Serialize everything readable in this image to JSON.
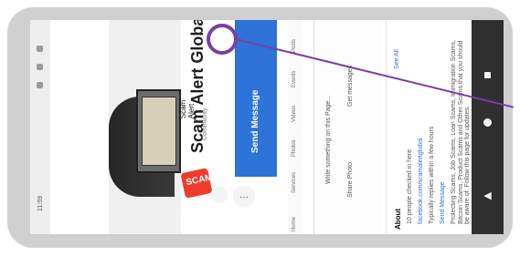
{
  "status_bar": {
    "time": "11:59"
  },
  "hero": {
    "sign_text": "Scam Alert"
  },
  "profile": {
    "name": "Scam Alert Global",
    "meta": "Community",
    "logo_text": "SCAM"
  },
  "buttons": {
    "send_message": "Send Message"
  },
  "tabs": [
    "Home",
    "Services",
    "Photos",
    "Videos",
    "Events",
    "Posts"
  ],
  "composer": {
    "placeholder": "Write something on this Page...",
    "actions": [
      "Share Photo",
      "Get messages"
    ]
  },
  "about": {
    "title": "About",
    "link_text": "See All",
    "items": [
      "10 people checked in here",
      "facebook.com/scamalertglobal",
      "Typically replies within a few hours",
      "Send Message",
      "Protecting Scams, Job Scams, Loan Scams, Immigration Scams, Bitcoin Scams, Product Scams and Other Scams that you should be aware of. Follow this page for updates."
    ]
  },
  "navigation": {
    "buttons": [
      "recent-apps",
      "home",
      "back"
    ]
  }
}
